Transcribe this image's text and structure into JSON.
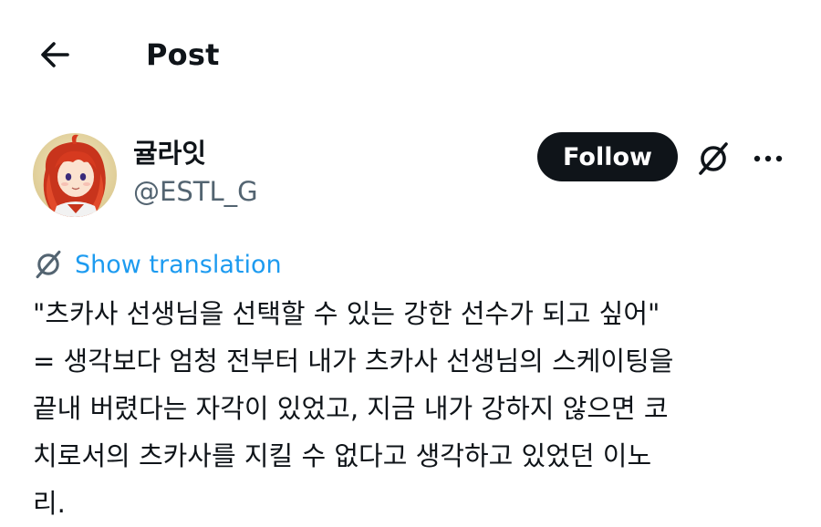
{
  "header": {
    "title": "Post"
  },
  "author": {
    "display_name": "귤라잇",
    "handle": "@ESTL_G",
    "follow_label": "Follow"
  },
  "translate": {
    "label": "Show translation"
  },
  "tweet": {
    "lines": [
      "\"츠카사 선생님을 선택할 수 있는 강한 선수가 되고 싶어\"",
      "= 생각보다 엄청 전부터 내가 츠카사 선생님의 스케이팅을",
      "끝내 버렸다는 자각이 있었고, 지금 내가 강하지 않으면 코",
      "치로서의 츠카사를 지킬 수 없다고 생각하고 있었던 이노",
      "리."
    ]
  },
  "colors": {
    "text": "#0f1419",
    "secondary": "#536471",
    "link": "#1d9bf0",
    "follow_bg": "#0f1419",
    "follow_text": "#ffffff"
  },
  "icons": {
    "back": "arrow-left-icon",
    "grok": "grok-icon",
    "more": "more-horizontal-icon",
    "translate": "grok-icon"
  }
}
